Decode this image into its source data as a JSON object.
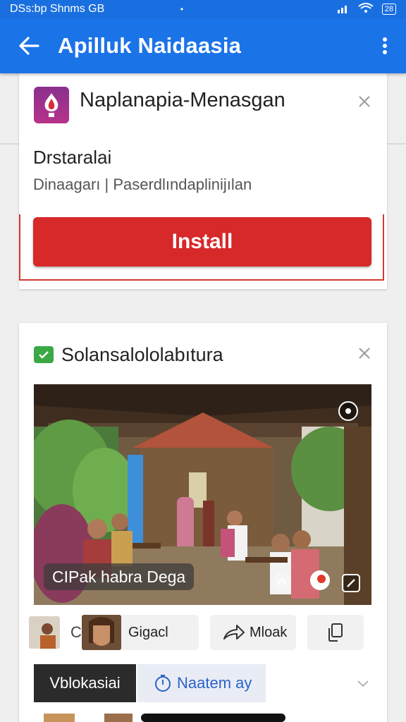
{
  "status_bar": {
    "left_text": "DSs:bp Shnms GB",
    "dot": "•",
    "battery": "28"
  },
  "app_bar": {
    "title": "Apilluk Naidaasia"
  },
  "ad_card": {
    "app_name": "Naplanapia-Menasgan",
    "subtitle": "Drstaralai",
    "description": "Dinaagarı | Paserdlındaplinijılan",
    "install_label": "Install"
  },
  "content_card": {
    "title": "Solansalololabıtura",
    "caption": "CIPak habra Dega",
    "actions": {
      "chip1_label": "Gigacl",
      "chip2_label": "Mloak"
    },
    "tabs": {
      "dark_label": "Vblokasiai",
      "light_label": "Naatem ay"
    }
  },
  "colors": {
    "app_bar": "#1b73e8",
    "install": "#d7282a",
    "check": "#39a845",
    "tab_light_text": "#2b62c9"
  }
}
